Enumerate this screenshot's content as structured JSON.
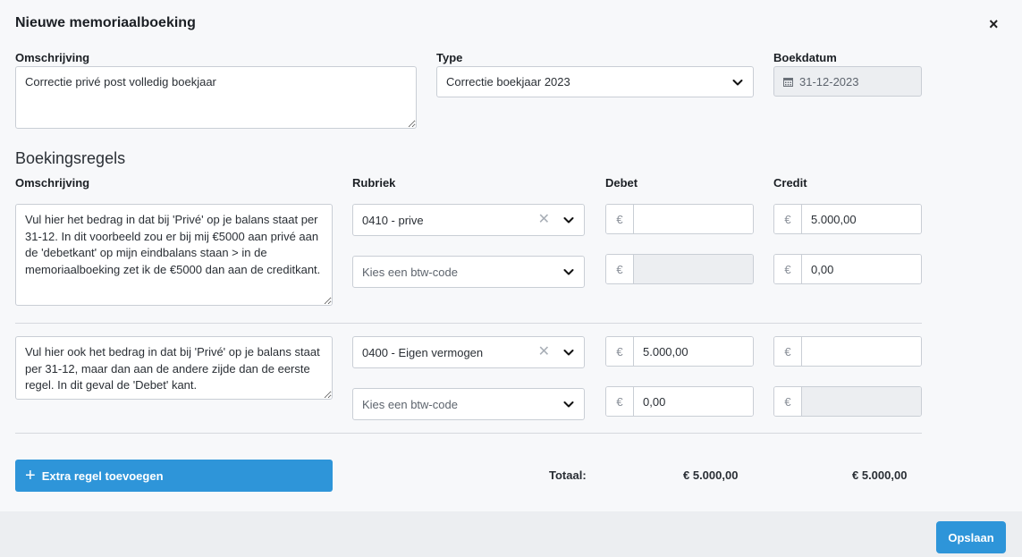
{
  "dialog": {
    "title": "Nieuwe memoriaalboeking",
    "close": "×"
  },
  "header": {
    "omschrijving_label": "Omschrijving",
    "omschrijving_value": "Correctie privé post volledig boekjaar",
    "type_label": "Type",
    "type_value": "Correctie boekjaar 2023",
    "boekdatum_label": "Boekdatum",
    "boekdatum_value": "31-12-2023"
  },
  "section_title": "Boekingsregels",
  "columns": {
    "omschrijving": "Omschrijving",
    "rubriek": "Rubriek",
    "debet": "Debet",
    "credit": "Credit"
  },
  "currency": "€",
  "rows": [
    {
      "description": "Vul hier het bedrag in dat bij 'Privé' op je balans staat per 31-12. In dit voorbeeld zou er bij mij €5000 aan privé aan de 'debetkant' op mijn eindbalans staan > in de memoriaalboeking zet ik de €5000 dan aan de creditkant.",
      "rubriek": "0410 - prive",
      "btw_placeholder": "Kies een btw-code",
      "debet": "",
      "credit": "5.000,00",
      "btw_debet": "",
      "btw_credit": "0,00"
    },
    {
      "description": "Vul hier ook het bedrag in dat bij 'Privé' op je balans staat per 31-12, maar dan aan de andere zijde dan de eerste regel. In dit geval de 'Debet' kant.",
      "rubriek": "0400 - Eigen vermogen",
      "btw_placeholder": "Kies een btw-code",
      "debet": "5.000,00",
      "credit": "",
      "btw_debet": "0,00",
      "btw_credit": ""
    }
  ],
  "add_row_label": "Extra regel toevoegen",
  "totals": {
    "label": "Totaal:",
    "debet": "€ 5.000,00",
    "credit": "€ 5.000,00"
  },
  "save_label": "Opslaan",
  "colors": {
    "accent": "#2e95d9",
    "disabled": "#eceef1",
    "border": "#c9ced5"
  }
}
